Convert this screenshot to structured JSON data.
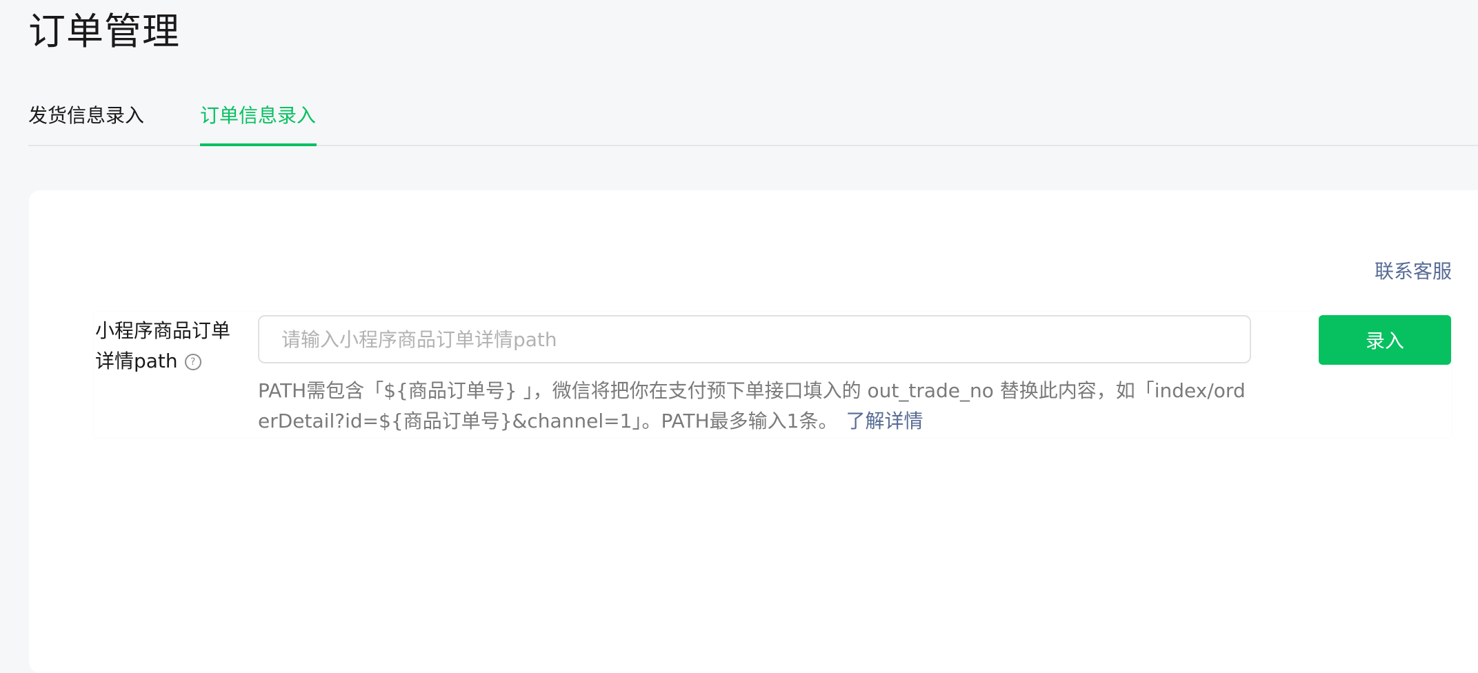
{
  "page": {
    "title": "订单管理"
  },
  "tabs": [
    {
      "label": "发货信息录入"
    },
    {
      "label": "订单信息录入"
    }
  ],
  "contact_label": "联系客服",
  "form": {
    "label_line1": "小程序商品订单",
    "label_line2": "详情path",
    "help_glyph": "?",
    "input_placeholder": "请输入小程序商品订单详情path",
    "input_value": "",
    "submit_label": "录入",
    "hint_text": "PATH需包含「${商品订单号} 」，微信将把你在支付预下单接口填入的 out_trade_no 替换此内容，如「index/orderDetail?id=${商品订单号}&channel=1」。PATH最多输入1条。",
    "learn_more_label": "了解详情"
  },
  "colors": {
    "accent": "#07c160",
    "link": "#576b95",
    "background": "#f6f7f9"
  }
}
